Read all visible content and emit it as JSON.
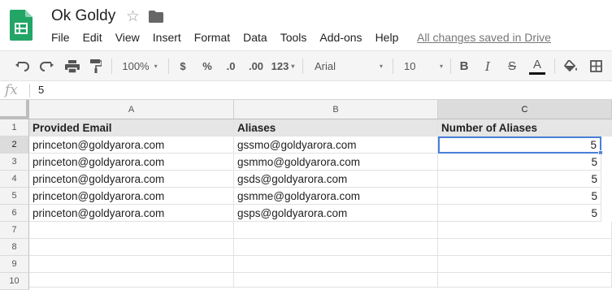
{
  "doc": {
    "title": "Ok Goldy",
    "saved_status": "All changes saved in Drive",
    "icons": {
      "app": "sheets-logo-icon",
      "star": "star-icon",
      "folder": "folder-icon"
    }
  },
  "menu": [
    "File",
    "Edit",
    "View",
    "Insert",
    "Format",
    "Data",
    "Tools",
    "Add-ons",
    "Help"
  ],
  "toolbar": {
    "zoom": "100%",
    "currency": "$",
    "percent": "%",
    "decrease_decimals": ".0",
    "increase_decimals": ".00",
    "more_formats": "123",
    "font": "Arial",
    "font_size": "10",
    "bold": "B",
    "italic": "I",
    "strikethrough": "S",
    "text_color": "A"
  },
  "formula_bar": {
    "icon": "fx",
    "value": "5"
  },
  "sheet": {
    "columns": [
      "A",
      "B",
      "C"
    ],
    "selected_column": "C",
    "rows": [
      "1",
      "2",
      "3",
      "4",
      "5",
      "6",
      "7",
      "8",
      "9",
      "10"
    ],
    "selected_row": "2",
    "header_row": [
      "Provided Email",
      "Aliases",
      "Number of Aliases"
    ],
    "data": [
      [
        "princeton@goldyarora.com",
        "gssmo@goldyarora.com",
        "5"
      ],
      [
        "princeton@goldyarora.com",
        "gsmmo@goldyarora.com",
        "5"
      ],
      [
        "princeton@goldyarora.com",
        "gsds@goldyarora.com",
        "5"
      ],
      [
        "princeton@goldyarora.com",
        "gsmme@goldyarora.com",
        "5"
      ],
      [
        "princeton@goldyarora.com",
        "gsps@goldyarora.com",
        "5"
      ]
    ],
    "active_cell": "C2"
  }
}
